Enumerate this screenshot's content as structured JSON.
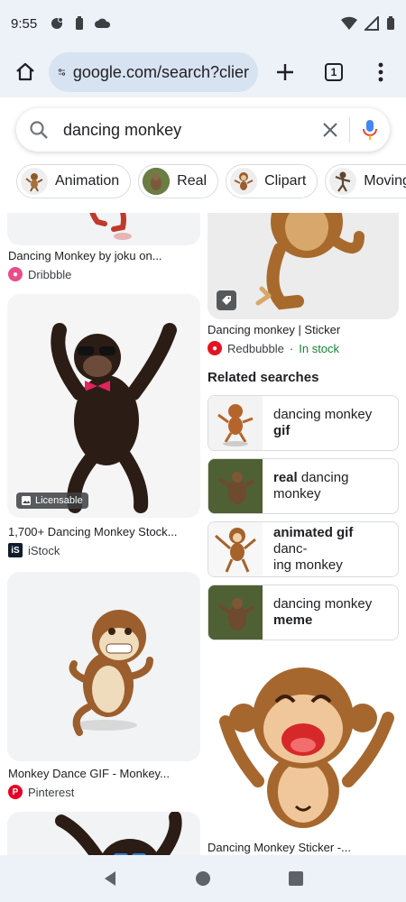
{
  "status": {
    "time": "9:55"
  },
  "browser": {
    "url": "google.com/search?clier",
    "tab_count": "1"
  },
  "search": {
    "query": "dancing monkey"
  },
  "chips": [
    {
      "label": "Animation"
    },
    {
      "label": "Real"
    },
    {
      "label": "Clipart"
    },
    {
      "label": "Moving"
    }
  ],
  "results": {
    "left": [
      {
        "caption": "Dancing Monkey by joku on...",
        "source": "Dribbble"
      },
      {
        "caption": "1,700+ Dancing Monkey Stock...",
        "source": "iStock",
        "badge": "Licensable"
      },
      {
        "caption": "Monkey Dance GIF - Monkey...",
        "source": "Pinterest"
      }
    ],
    "right": [
      {
        "caption": "Dancing monkey | Sticker",
        "source": "Redbubble",
        "stock": "In stock"
      },
      {
        "caption": "Dancing Monkey Sticker -..."
      }
    ]
  },
  "related": {
    "title": "Related searches",
    "items": [
      {
        "line1": "dancing monkey",
        "line2": "gif"
      },
      {
        "line1": "real",
        "line1b": " dancing",
        "line2": "monkey"
      },
      {
        "line1": "animated gif",
        "line1b": " danc-",
        "line2": "ing monkey"
      },
      {
        "line1": "dancing monkey",
        "line2": "meme"
      }
    ]
  },
  "colors": {
    "accent": "#1a73e8",
    "bar_bg": "#edf1f8",
    "url_bg": "#d8e3f1",
    "in_stock": "#188038"
  }
}
